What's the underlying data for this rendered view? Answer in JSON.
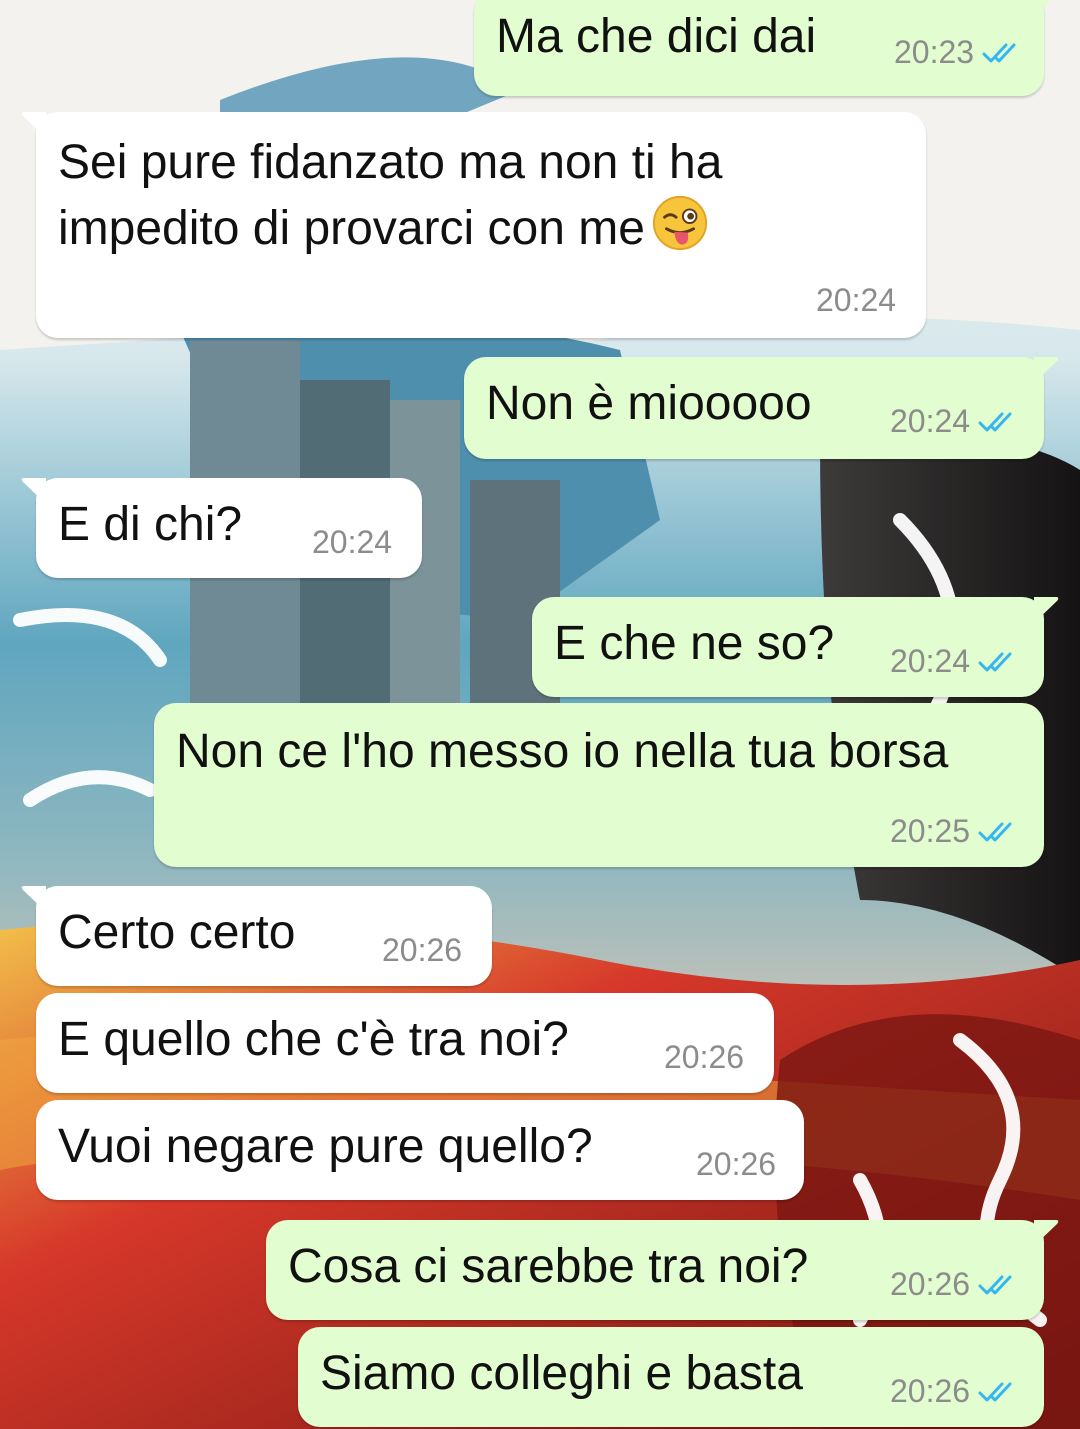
{
  "colors": {
    "incoming_bubble": "#ffffff",
    "outgoing_bubble": "#e2fdcf",
    "timestamp": "#8c8c8c",
    "read_ticks": "#34b7f1"
  },
  "messages": [
    {
      "direction": "out",
      "text": "Ma che dici dai",
      "time": "20:23",
      "status": "read-ticks-icon"
    },
    {
      "direction": "in",
      "lines": [
        "Sei pure fidanzato ma non ti ha",
        "impedito di provarci con me"
      ],
      "emoji": "winking-face-with-tongue-emoji",
      "time": "20:24"
    },
    {
      "direction": "out",
      "text": "Non è miooooo",
      "time": "20:24",
      "status": "read-ticks-icon"
    },
    {
      "direction": "in",
      "text": "E di chi?",
      "time": "20:24"
    },
    {
      "direction": "out",
      "text": "E che ne so?",
      "time": "20:24",
      "status": "read-ticks-icon"
    },
    {
      "direction": "out",
      "text": "Non ce l'ho messo io nella tua borsa",
      "time": "20:25",
      "status": "read-ticks-icon"
    },
    {
      "direction": "in",
      "text": "Certo certo",
      "time": "20:26"
    },
    {
      "direction": "in",
      "text": "E quello che c'è tra noi?",
      "time": "20:26"
    },
    {
      "direction": "in",
      "text": "Vuoi negare pure quello?",
      "time": "20:26"
    },
    {
      "direction": "out",
      "text": "Cosa ci sarebbe tra noi?",
      "time": "20:26",
      "status": "read-ticks-icon"
    },
    {
      "direction": "out",
      "text": "Siamo colleghi e basta",
      "time": "20:26",
      "status": "read-ticks-icon"
    }
  ]
}
